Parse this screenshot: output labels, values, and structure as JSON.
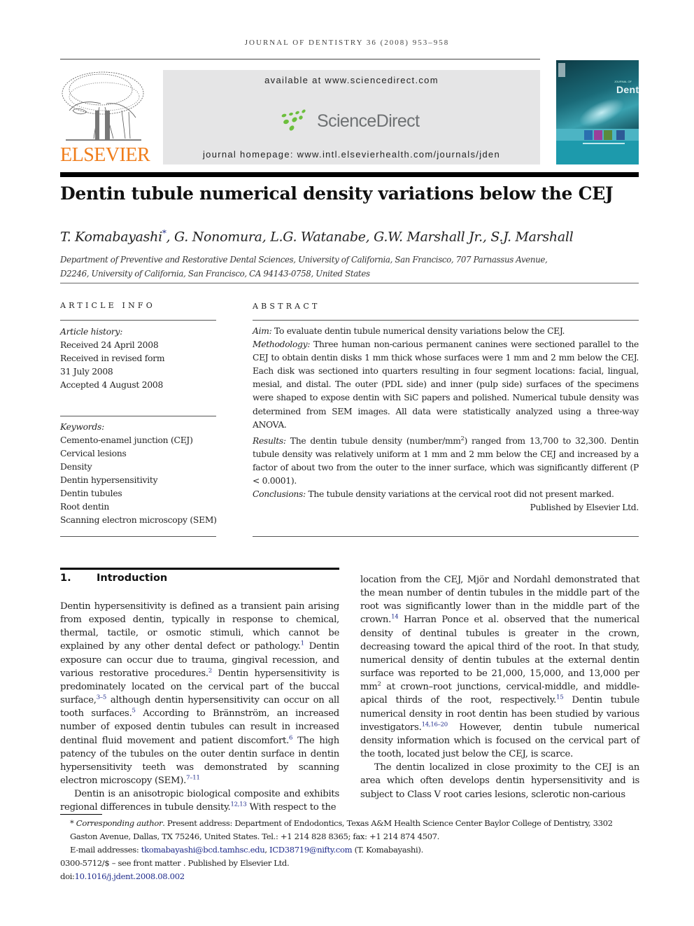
{
  "header": {
    "running_head": "JOURNAL OF DENTISTRY 36 (2008) 953–958",
    "publisher_wordmark": "ELSEVIER",
    "available_at": "available at www.sciencedirect.com",
    "sd_wordmark": "ScienceDirect",
    "journal_homepage": "journal homepage: www.intl.elsevierhealth.com/journals/jden",
    "cover_title": "Dentistry",
    "cover_subtitle": "JOURNAL OF",
    "colors": {
      "elsevier_orange": "#f07d1a",
      "sd_green": "#6cbf3c",
      "sd_gray": "#6e7173",
      "banner_bg": "#e5e5e6",
      "cover_teal": "#1d9aac",
      "link_blue": "#1e2a8a"
    }
  },
  "article": {
    "title": "Dentin tubule numerical density variations below the CEJ",
    "authors_first": "T. Komabayashi",
    "author_mark": "*",
    "authors_rest": ", G. Nonomura, L.G. Watanabe, G.W. Marshall Jr., S.J. Marshall",
    "affiliation_line1": "Department of Preventive and Restorative Dental Sciences, University of California, San Francisco, 707 Parnassus Avenue,",
    "affiliation_line2": "D2246, University of California, San Francisco, CA 94143-0758, United States"
  },
  "article_info": {
    "heading": "ARTICLE INFO",
    "history_label": "Article history:",
    "history": [
      "Received 24 April 2008",
      "Received in revised form",
      "31 July 2008",
      "Accepted 4 August 2008"
    ],
    "keywords_label": "Keywords:",
    "keywords": [
      "Cemento-enamel junction (CEJ)",
      "Cervical lesions",
      "Density",
      "Dentin hypersensitivity",
      "Dentin tubules",
      "Root dentin",
      "Scanning electron microscopy (SEM)"
    ]
  },
  "abstract": {
    "heading": "ABSTRACT",
    "sections": [
      {
        "label": "Aim:",
        "text": " To evaluate dentin tubule numerical density variations below the CEJ."
      },
      {
        "label": "Methodology:",
        "text": " Three human non-carious permanent canines were sectioned parallel to the CEJ to obtain dentin disks 1 mm thick whose surfaces were 1 mm and 2 mm below the CEJ. Each disk was sectioned into quarters resulting in four segment locations: facial, lingual, mesial, and distal. The outer (PDL side) and inner (pulp side) surfaces of the specimens were shaped to expose dentin with SiC papers and polished. Numerical tubule density was determined from SEM images. All data were statistically analyzed using a three-way ANOVA."
      },
      {
        "label": "Results:",
        "text_a": " The dentin tubule density (number/mm",
        "sup": "2",
        "text_b": ") ranged from 13,700 to 32,300. Dentin tubule density was relatively uniform at 1 mm and 2 mm below the CEJ and increased by a factor of about two from the outer to the inner surface, which was significantly different (P < 0.0001)."
      },
      {
        "label": "Conclusions:",
        "text": " The tubule density variations at the cervical root did not present marked."
      }
    ],
    "publisher_note": "Published by Elsevier Ltd."
  },
  "section1": {
    "number": "1.",
    "title": "Introduction",
    "left_col": {
      "p1_a": "Dentin hypersensitivity is defined as a transient pain arising from exposed dentin, typically in response to chemical, thermal, tactile, or osmotic stimuli, which cannot be explained by any other dental defect or pathology.",
      "ref1": "1",
      "p1_b": " Dentin exposure can occur due to trauma, gingival recession, and various restorative procedures.",
      "ref2": "2",
      "p1_c": " Dentin hypersensitivity is predominately located on the cervical part of the buccal surface,",
      "ref3": "3–5",
      "p1_d": " although dentin hypersensitivity can occur on all tooth surfaces.",
      "ref4": "5",
      "p1_e": " According to Brännström, an increased number of exposed dentin tubules can result in increased dentinal fluid movement and patient discomfort.",
      "ref5": "6",
      "p1_f": " The high patency of the tubules on the outer dentin surface in dentin hypersensitivity teeth was demonstrated by scanning electron microscopy (SEM).",
      "ref6": "7–11",
      "p2_a": "Dentin is an anisotropic biological composite and exhibits regional differences in tubule density.",
      "ref7": "12,13",
      "p2_b": " With respect to the"
    },
    "right_col": {
      "p1_a": "location from the CEJ, Mjör and Nordahl demonstrated that the mean number of dentin tubules in the middle part of the root was significantly lower than in the middle part of the crown.",
      "ref1": "14",
      "p1_b": " Harran Ponce et al. observed that the numerical density of dentinal tubules is greater in the crown, decreasing toward the apical third of the root. In that study, numerical density of dentin tubules at the external dentin surface was reported to be 21,000, 15,000, and 13,000 per mm",
      "sup2": "2",
      "p1_c": " at crown–root junctions, cervical-middle, and middle-apical thirds of the root, respectively.",
      "ref2": "15",
      "p1_d": " Dentin tubule numerical density in root dentin has been studied by various investigators.",
      "ref3": "14,16–20",
      "p1_e": " However, dentin tubule numerical density information which is focused on the cervical part of the tooth, located just below the CEJ, is scarce.",
      "p2": "The dentin localized in close proximity to the CEJ is an area which often develops dentin hypersensitivity and is subject to Class V root caries lesions, sclerotic non-carious"
    }
  },
  "footnotes": {
    "mark": "*",
    "corresponding_label": "Corresponding author",
    "corresponding_text": ". Present address: Department of Endodontics, Texas A&M Health Science Center Baylor College of Dentistry, 3302 Gaston Avenue, Dallas, TX 75246, United States. Tel.: +1 214 828 8365; fax: +1 214 874 4507.",
    "email_label": "E-mail addresses: ",
    "email1": "tkomabayashi@bcd.tamhsc.edu",
    "email_sep": ", ",
    "email2": "ICD38719@nifty.com",
    "email_owner": " (T. Komabayashi).",
    "copyright": "0300-5712/$ – see front matter . Published by Elsevier Ltd.",
    "doi_label": "doi:",
    "doi": "10.1016/j.jdent.2008.08.002"
  }
}
